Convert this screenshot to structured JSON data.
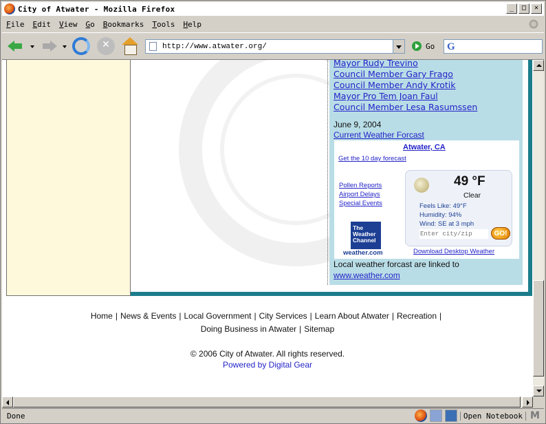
{
  "window": {
    "title": "City of Atwater - Mozilla Firefox"
  },
  "menu": [
    "File",
    "Edit",
    "View",
    "Go",
    "Bookmarks",
    "Tools",
    "Help"
  ],
  "toolbar": {
    "url": "http://www.atwater.org/",
    "go_label": "Go"
  },
  "council": [
    "Mayor Rudy Trevino",
    "Council Member Gary Frago",
    "Council Member Andy Krotik",
    "Mayor Pro Tem Joan Faul",
    "Council Member Lesa Rasumssen"
  ],
  "news": {
    "date": "June 9, 2004",
    "weather_link": "Current Weather Forcast"
  },
  "weather": {
    "city": "Atwater, CA",
    "ten_day": "Get the 10 day forecast",
    "links": [
      "Pollen Reports",
      "Airport Delays",
      "Special Events"
    ],
    "logo_text": "The Weather Channel",
    "logo_url": "weather.com",
    "temp": "49 °F",
    "condition": "Clear",
    "feels_like": "Feels Like: 49°F",
    "humidity": "Humidity: 94%",
    "wind": "Wind: SE at 3 mph",
    "zip_placeholder": "Enter city/zip",
    "go_label": "GO!",
    "download": "Download Desktop Weather"
  },
  "linked": {
    "text": "Local weather forcast are linked to",
    "url": "www.weather.com"
  },
  "footer": {
    "nav_row1": [
      "Home",
      "News & Events",
      "Local Government",
      "City Services",
      "Learn About Atwater",
      "Recreation"
    ],
    "nav_row2": [
      "Doing Business in Atwater",
      "Sitemap"
    ],
    "copyright": "© 2006 City of Atwater. All rights reserved.",
    "powered": "Powered by Digital Gear"
  },
  "status": {
    "text": "Done",
    "notebook": "Open Notebook"
  },
  "colors": {
    "teal": "#1b7d8b",
    "sidebar_bg": "#fff9dc",
    "weather_bg": "#b9dde6",
    "link": "#2323c8"
  }
}
